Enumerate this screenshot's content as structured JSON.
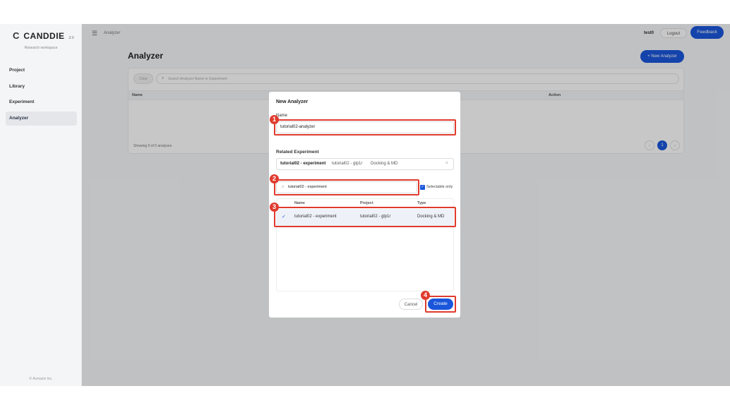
{
  "app": {
    "logo_mark": "C",
    "logo_text": "CANDDIE",
    "logo_version": "2.0",
    "workspace": "Research workspace",
    "copyright": "© Acmazix Inc."
  },
  "sidebar": {
    "items": [
      {
        "label": "Project"
      },
      {
        "label": "Library"
      },
      {
        "label": "Experiment"
      },
      {
        "label": "Analyzer"
      }
    ]
  },
  "topbar": {
    "breadcrumb": "Analyzer",
    "user": "test0",
    "logout": "Logout",
    "feedback": "Feedback"
  },
  "page": {
    "title": "Analyzer",
    "new_button": "+ New Analyzer",
    "clear": "Clear",
    "search_placeholder": "Search Analyzer Name or Experiment",
    "columns": {
      "name": "Name",
      "action": "Action"
    },
    "showing": "Showing 0 of 0 analyses",
    "prev": "‹",
    "current_page": "1",
    "next": "›"
  },
  "modal": {
    "title": "New Analyzer",
    "name_label": "Name",
    "name_value": "tutorial02-analyzer",
    "related_label": "Related Experiment",
    "tag_experiment": "tutorial02 - experiment",
    "tag_project": "tutorial02 - glp1r",
    "tag_type": "Docking & MD",
    "tag_clear": "×",
    "search_value": "tutorial02 - experiment",
    "selectable_only": "Selectable only",
    "list_columns": {
      "name": "Name",
      "project": "Project",
      "type": "Type"
    },
    "rows": [
      {
        "check": "✓",
        "name": "tutorial02 - experiment",
        "project": "tutorial02 - glp1r",
        "type": "Docking & MD"
      }
    ],
    "cancel": "Cancel",
    "create": "Create"
  },
  "annotations": {
    "badges": [
      "1",
      "2",
      "3",
      "4"
    ],
    "color": "#e03b2e"
  },
  "colors": {
    "accent": "#1a56db",
    "annotation": "#e03b2e"
  },
  "icons": {
    "hamburger": "menu-icon",
    "search": "search-icon",
    "check": "checkmark-icon",
    "clear": "close-icon"
  }
}
